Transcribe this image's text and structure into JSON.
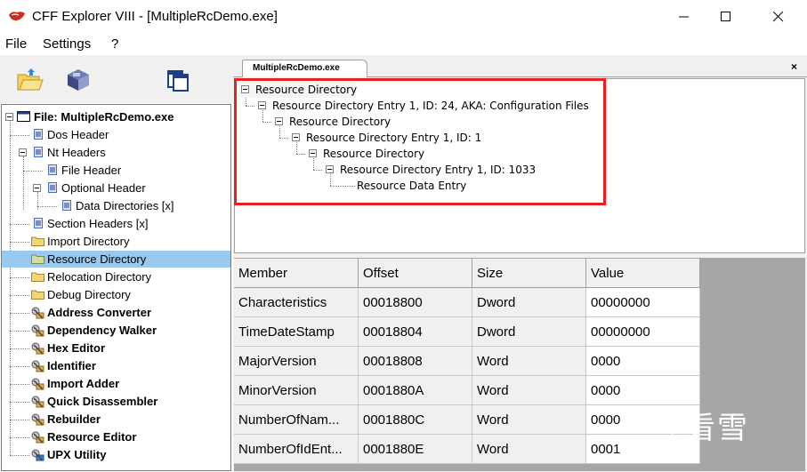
{
  "window": {
    "title": "CFF Explorer VIII - [MultipleRcDemo.exe]"
  },
  "menu": [
    "File",
    "Settings",
    "?"
  ],
  "toolbar": {
    "icons": [
      "open-folder-icon",
      "save-disk-icon",
      "windows-icon"
    ]
  },
  "tree": {
    "items": [
      {
        "label": "File: MultipleRcDemo.exe",
        "icon": "window-icon",
        "bold": true
      },
      {
        "label": "Dos Header",
        "icon": "doc-icon"
      },
      {
        "label": "Nt Headers",
        "icon": "doc-icon"
      },
      {
        "label": "File Header",
        "icon": "doc-icon"
      },
      {
        "label": "Optional Header",
        "icon": "doc-icon"
      },
      {
        "label": "Data Directories [x]",
        "icon": "doc-icon"
      },
      {
        "label": "Section Headers [x]",
        "icon": "doc-icon"
      },
      {
        "label": "Import Directory",
        "icon": "folder-icon"
      },
      {
        "label": "Resource Directory",
        "icon": "folder-icon",
        "selected": true
      },
      {
        "label": "Relocation Directory",
        "icon": "folder-icon"
      },
      {
        "label": "Debug Directory",
        "icon": "folder-icon"
      },
      {
        "label": "Address Converter",
        "icon": "tool-icon",
        "bold": true
      },
      {
        "label": "Dependency Walker",
        "icon": "tool-icon",
        "bold": true
      },
      {
        "label": "Hex Editor",
        "icon": "tool-icon",
        "bold": true
      },
      {
        "label": "Identifier",
        "icon": "tool-icon",
        "bold": true
      },
      {
        "label": "Import Adder",
        "icon": "tool-icon",
        "bold": true
      },
      {
        "label": "Quick Disassembler",
        "icon": "tool-icon",
        "bold": true
      },
      {
        "label": "Rebuilder",
        "icon": "tool-icon",
        "bold": true
      },
      {
        "label": "Resource Editor",
        "icon": "tool-icon",
        "bold": true
      },
      {
        "label": "UPX Utility",
        "icon": "tool-icon",
        "bold": true
      }
    ]
  },
  "tab": {
    "label": "MultipleRcDemo.exe",
    "close": "×"
  },
  "resource_tree": [
    "Resource Directory",
    "Resource Directory Entry 1, ID: 24, AKA: Configuration Files",
    "Resource Directory",
    "Resource Directory Entry 1, ID: 1",
    "Resource Directory",
    "Resource Directory Entry 1, ID: 1033",
    "Resource Data Entry"
  ],
  "table": {
    "headers": [
      "Member",
      "Offset",
      "Size",
      "Value"
    ],
    "rows": [
      [
        "Characteristics",
        "00018800",
        "Dword",
        "00000000"
      ],
      [
        "TimeDateStamp",
        "00018804",
        "Dword",
        "00000000"
      ],
      [
        "MajorVersion",
        "00018808",
        "Word",
        "0000"
      ],
      [
        "MinorVersion",
        "0001880A",
        "Word",
        "0000"
      ],
      [
        "NumberOfNam...",
        "0001880C",
        "Word",
        "0000"
      ],
      [
        "NumberOfIdEnt...",
        "0001880E",
        "Word",
        "0001"
      ]
    ]
  },
  "watermark": "看雪",
  "colors": {
    "selection": "#99c9ef",
    "highlight_border": "#e8211f",
    "grid_background": "#a6a6a6"
  }
}
